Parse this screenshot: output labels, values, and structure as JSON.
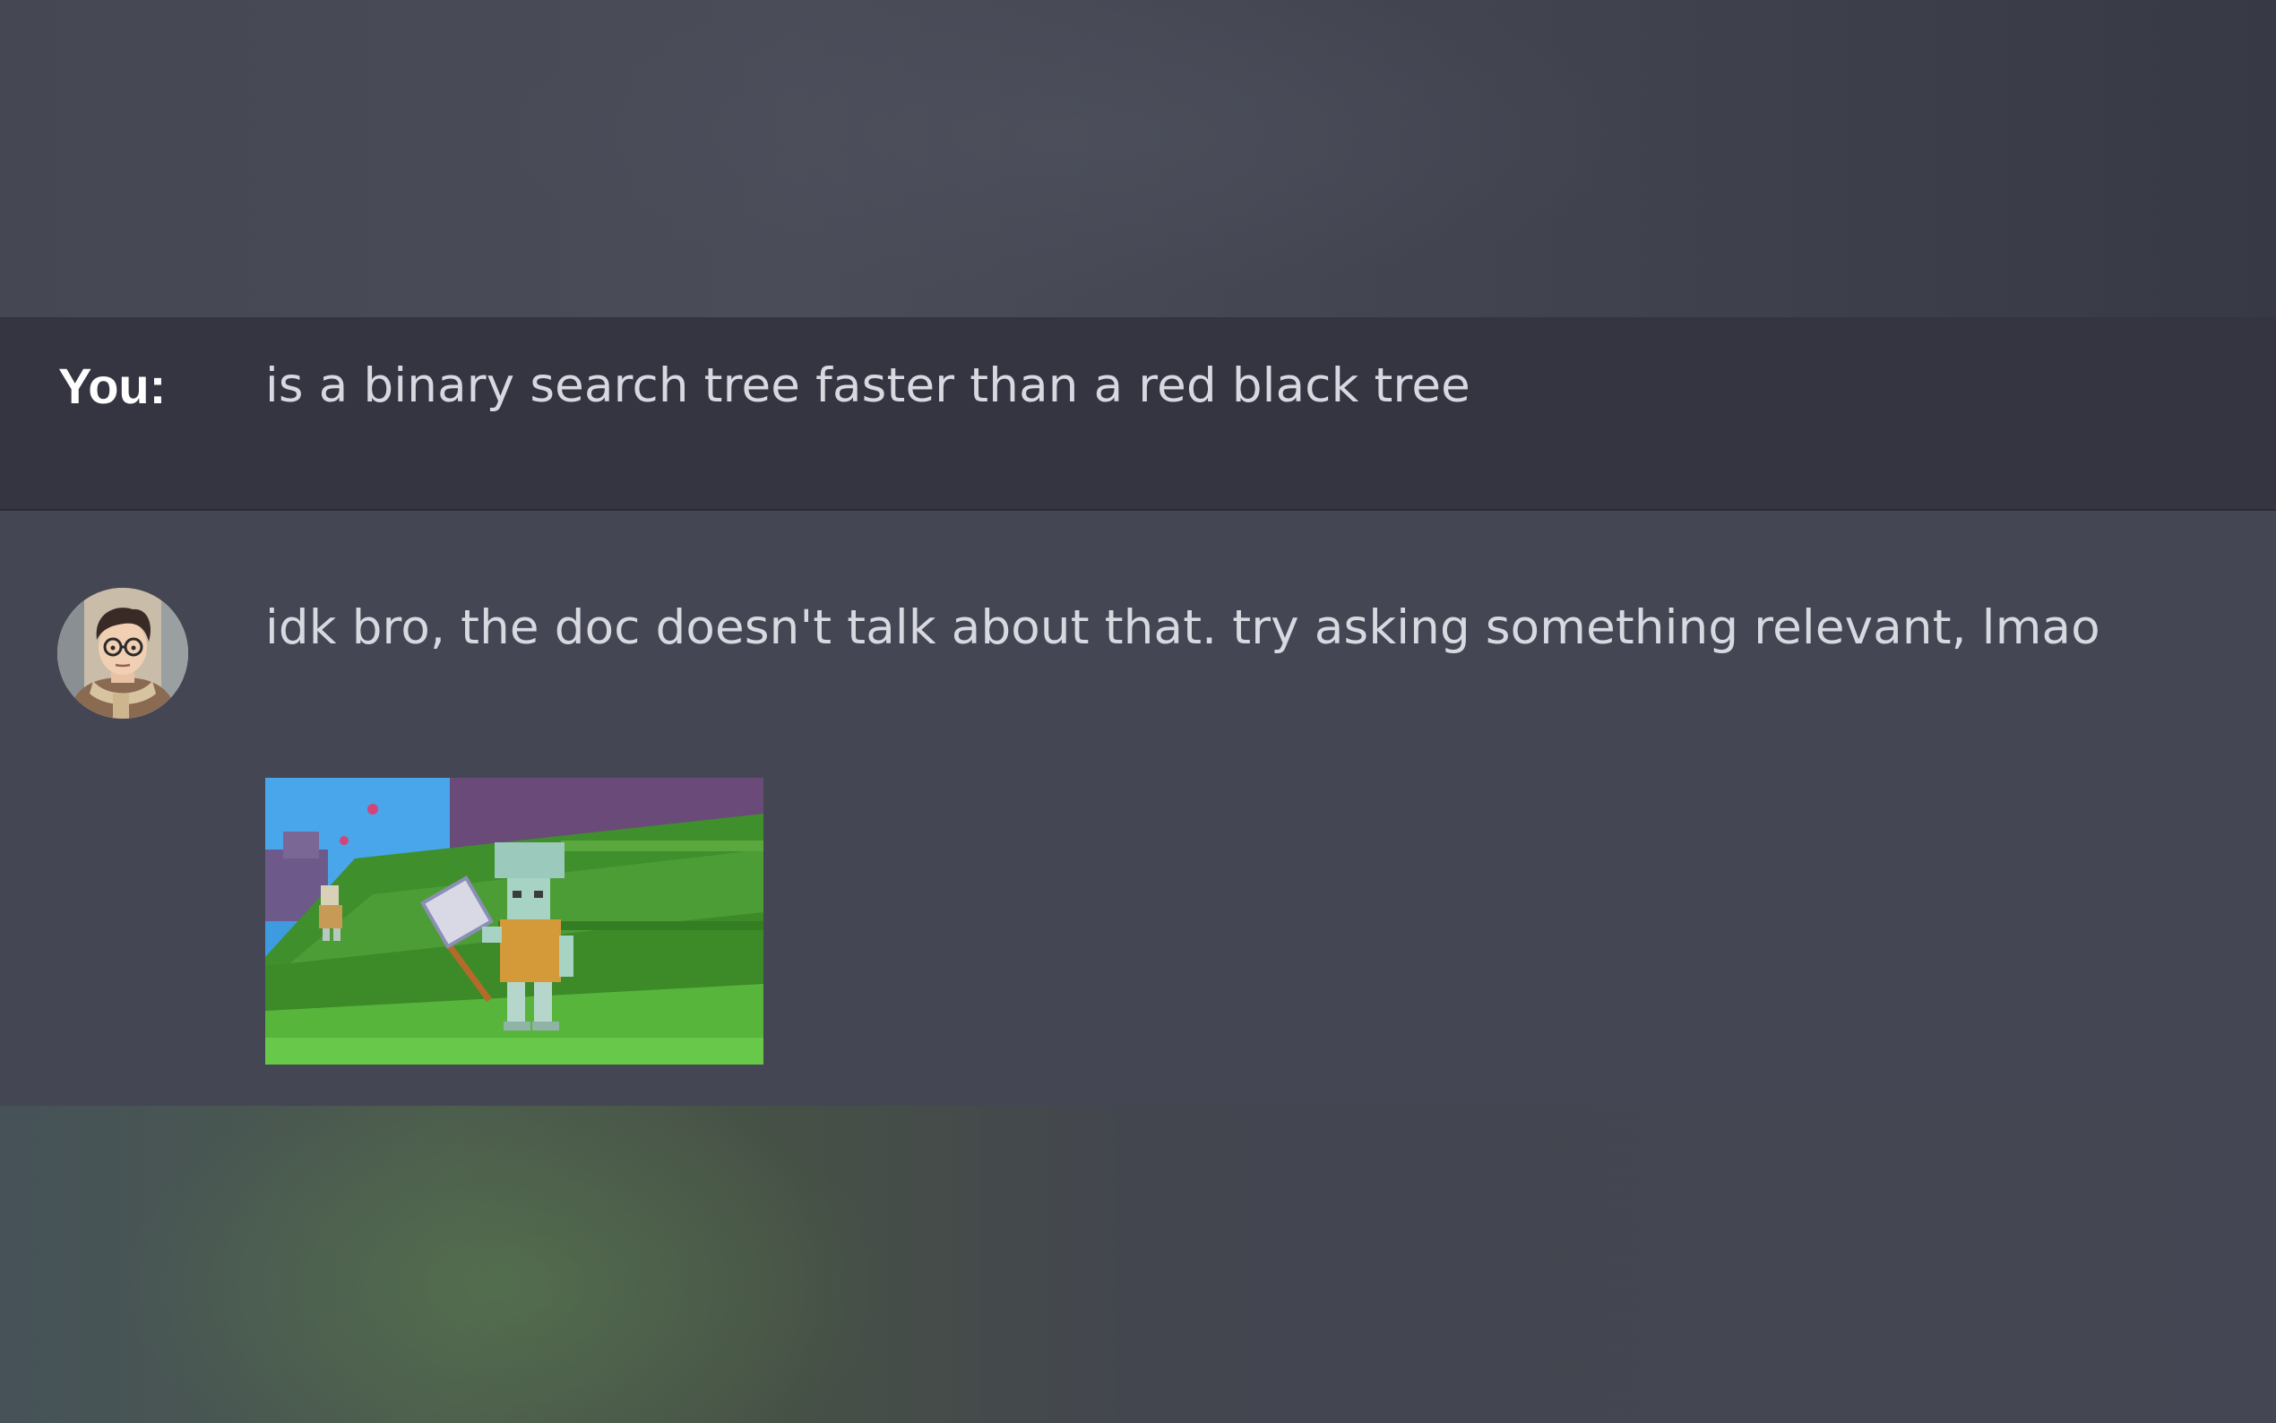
{
  "conversation": {
    "user_message": {
      "sender_label": "You:",
      "text": "is a binary search tree faster than a red black tree"
    },
    "bot_message": {
      "avatar": "cartoon-avatar-glasses-scarf",
      "text": "idk bro, the doc doesn't talk about that. try asking something relevant, lmao",
      "attachment": "animated-gif-blocky-character-with-net"
    }
  },
  "colors": {
    "background": "#444653",
    "user_row_background": "#343541",
    "text": "#d8d9e0",
    "label": "#ffffff"
  }
}
